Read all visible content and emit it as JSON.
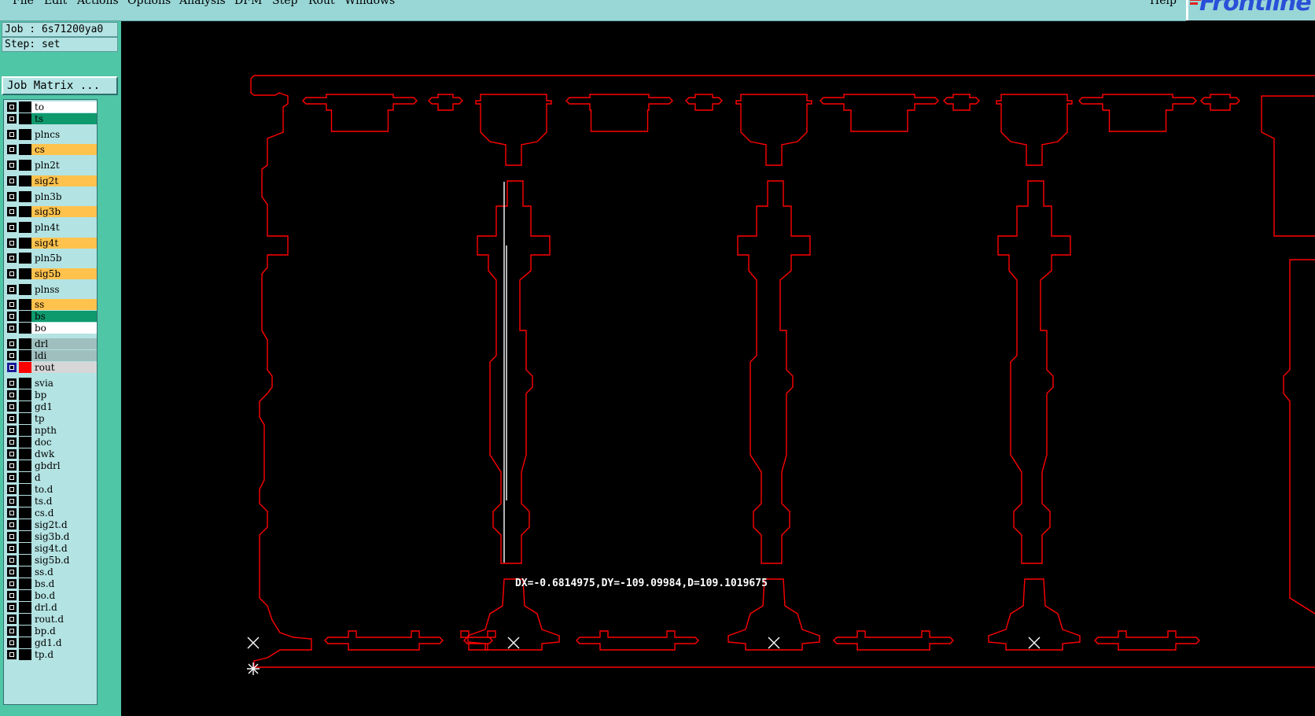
{
  "menubar": {
    "items": [
      "File",
      "Edit",
      "Actions",
      "Options",
      "Analysis",
      "DFM",
      "Step",
      "Rout",
      "Windows"
    ],
    "help": "Help"
  },
  "logo": {
    "text": "Frontline"
  },
  "job": {
    "job_line": "Job : 6s71200ya0",
    "step_line": "Step: set"
  },
  "job_matrix_button": "Job Matrix ...",
  "layers": [
    {
      "name": "to",
      "color": "#ffffff"
    },
    {
      "name": "ts",
      "color": "#0f9a6e"
    },
    {
      "name": "plncs",
      "color": "#b4e3e3"
    },
    {
      "name": "cs",
      "color": "#ffc24d"
    },
    {
      "name": "pln2t",
      "color": "#b4e3e3"
    },
    {
      "name": "sig2t",
      "color": "#ffc24d"
    },
    {
      "name": "pln3b",
      "color": "#b4e3e3"
    },
    {
      "name": "sig3b",
      "color": "#ffc24d"
    },
    {
      "name": "pln4t",
      "color": "#b4e3e3"
    },
    {
      "name": "sig4t",
      "color": "#ffc24d"
    },
    {
      "name": "pln5b",
      "color": "#b4e3e3"
    },
    {
      "name": "sig5b",
      "color": "#ffc24d"
    },
    {
      "name": "plnss",
      "color": "#b4e3e3"
    },
    {
      "name": "ss",
      "color": "#ffc24d"
    },
    {
      "name": "bs",
      "color": "#0f9a6e"
    },
    {
      "name": "bo",
      "color": "#ffffff"
    },
    {
      "name": "drl",
      "color": "#9fbfbf"
    },
    {
      "name": "ldi",
      "color": "#9fbfbf"
    },
    {
      "name": "rout",
      "color": "#d7d7d7",
      "active": true
    },
    {
      "name": "svia",
      "color": "#b4e3e3"
    },
    {
      "name": "bp",
      "color": "#b4e3e3"
    },
    {
      "name": "gd1",
      "color": "#b4e3e3"
    },
    {
      "name": "tp",
      "color": "#b4e3e3"
    },
    {
      "name": "npth",
      "color": "#b4e3e3"
    },
    {
      "name": "doc",
      "color": "#b4e3e3"
    },
    {
      "name": "dwk",
      "color": "#b4e3e3"
    },
    {
      "name": "gbdrl",
      "color": "#b4e3e3"
    },
    {
      "name": "d",
      "color": "#b4e3e3"
    },
    {
      "name": "to.d",
      "color": "#b4e3e3"
    },
    {
      "name": "ts.d",
      "color": "#b4e3e3"
    },
    {
      "name": "cs.d",
      "color": "#b4e3e3"
    },
    {
      "name": "sig2t.d",
      "color": "#b4e3e3"
    },
    {
      "name": "sig3b.d",
      "color": "#b4e3e3"
    },
    {
      "name": "sig4t.d",
      "color": "#b4e3e3"
    },
    {
      "name": "sig5b.d",
      "color": "#b4e3e3"
    },
    {
      "name": "ss.d",
      "color": "#b4e3e3"
    },
    {
      "name": "bs.d",
      "color": "#b4e3e3"
    },
    {
      "name": "bo.d",
      "color": "#b4e3e3"
    },
    {
      "name": "drl.d",
      "color": "#b4e3e3"
    },
    {
      "name": "rout.d",
      "color": "#b4e3e3"
    },
    {
      "name": "bp.d",
      "color": "#b4e3e3"
    },
    {
      "name": "gd1.d",
      "color": "#b4e3e3"
    },
    {
      "name": "tp.d",
      "color": "#b4e3e3"
    }
  ],
  "measurement": "DX=-0.6814975,DY=-109.09984,D=109.1019675",
  "colors": {
    "menubar": "#99d6d6",
    "panel": "#4fc7a7",
    "rout_outline": "#ff0000",
    "measure_line": "#ffffff",
    "canvas_bg": "#000000"
  }
}
